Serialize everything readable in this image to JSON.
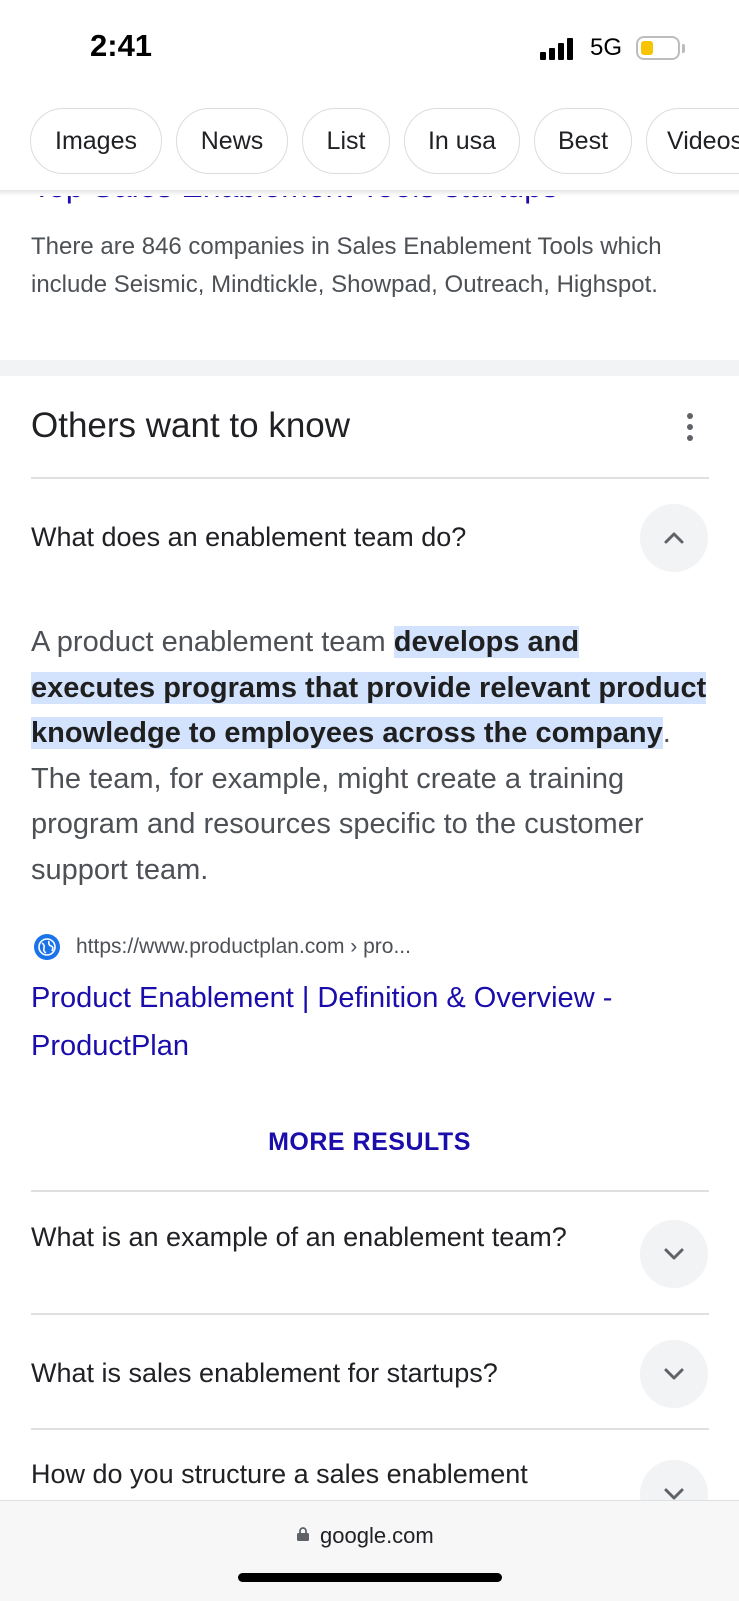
{
  "status_bar": {
    "time": "2:41",
    "network": "5G",
    "battery_color": "#f6c400"
  },
  "chips": [
    "Images",
    "News",
    "List",
    "In usa",
    "Best",
    "Videos"
  ],
  "top_result": {
    "title": "Top Sales Enablement Tools startups",
    "snippet": "There are 846 companies in Sales Enablement Tools which include Seismic, Mindtickle, Showpad, Outreach, Highspot."
  },
  "others_want_to_know": {
    "title": "Others want to know",
    "expanded": {
      "question": "What does an enablement team do?",
      "answer_prefix": "A product enablement team ",
      "answer_highlight": "develops and executes programs that provide relevant product knowledge to employees across the company",
      "answer_suffix": ". The team, for example, might create a training program and resources specific to the customer support team.",
      "source_url": "https://www.productplan.com › pro...",
      "source_title": "Product Enablement | Definition & Overview - ProductPlan",
      "more_results": "MORE RESULTS"
    },
    "questions": [
      "What is an example of an enablement team?",
      "What is sales enablement for startups?",
      "How do you structure a sales enablement team?"
    ]
  },
  "browser": {
    "url": "google.com"
  },
  "colors": {
    "link": "#1a0dab",
    "highlight": "#d3e3fd",
    "chip_border": "#dadce0"
  }
}
